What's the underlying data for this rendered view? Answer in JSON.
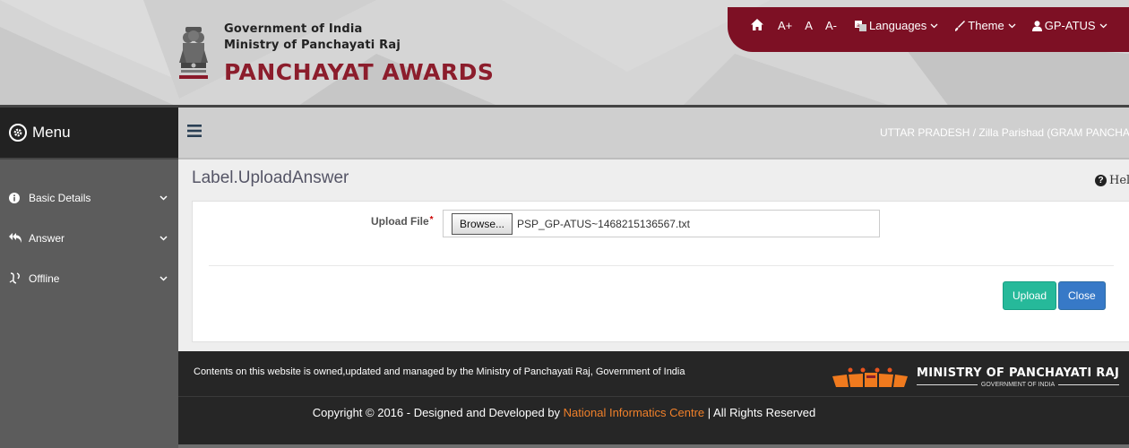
{
  "header": {
    "line1": "Government of India",
    "line2": "Ministry of Panchayati Raj",
    "title": "PANCHAYAT AWARDS",
    "emblem_icon": "national-emblem-icon"
  },
  "topbar": {
    "home_icon": "home-icon",
    "font_increase": "A+",
    "font_normal": "A",
    "font_decrease": "A-",
    "languages": "Languages",
    "theme": "Theme",
    "user": "GP-ATUS"
  },
  "sidebar": {
    "menu_label": "Menu",
    "items": [
      {
        "label": "Basic Details",
        "icon": "info-icon"
      },
      {
        "label": "Answer",
        "icon": "reply-all-icon"
      },
      {
        "label": "Offline",
        "icon": "offline-icon"
      }
    ]
  },
  "main": {
    "breadcrumb": "UTTAR PRADESH / Zilla Parishad (GRAM PANCHAY",
    "page_title": "Label.UploadAnswer",
    "help": "Help",
    "upload_label": "Upload File",
    "required_mark": "*",
    "browse_label": "Browse...",
    "file_name": "PSP_GP-ATUS~1468215136567.txt",
    "upload_button": "Upload",
    "close_button": "Close"
  },
  "footer": {
    "ownership": "Contents on this website is owned,updated and managed by the Ministry of Panchayati Raj, Government of India",
    "copyright_prefix": "Copyright © 2016 - Designed and Developed by ",
    "nic": "National Informatics Centre",
    "copyright_suffix": " | All Rights Reserved",
    "mopr_title": "MINISTRY OF PANCHAYATI RAJ",
    "mopr_sub": "GOVERNMENT OF INDIA"
  },
  "colors": {
    "topbar": "#7d1024",
    "brand_title": "#8c1d2c",
    "upload_button": "#26b99a",
    "close_button": "#3779c7",
    "nic_link": "#f0802a"
  }
}
